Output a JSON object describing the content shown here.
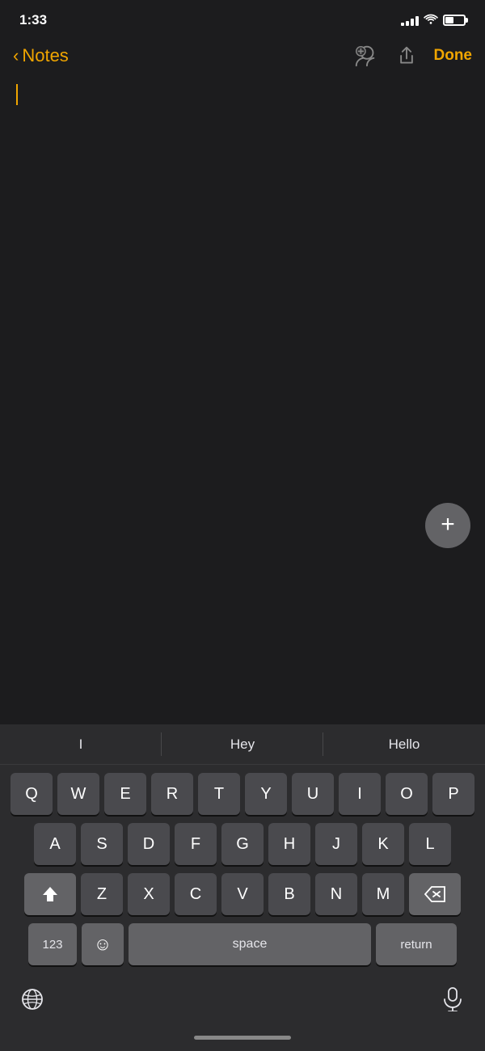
{
  "statusBar": {
    "time": "1:33"
  },
  "navBar": {
    "backLabel": "Notes",
    "doneLabel": "Done"
  },
  "predictive": {
    "items": [
      "I",
      "Hey",
      "Hello"
    ]
  },
  "keyboard": {
    "row1": [
      "Q",
      "W",
      "E",
      "R",
      "T",
      "Y",
      "U",
      "I",
      "O",
      "P"
    ],
    "row2": [
      "A",
      "S",
      "D",
      "F",
      "G",
      "H",
      "J",
      "K",
      "L"
    ],
    "row3": [
      "Z",
      "X",
      "C",
      "V",
      "B",
      "N",
      "M"
    ],
    "bottomRow": {
      "num": "123",
      "space": "space",
      "ret": "return"
    }
  },
  "addButton": {
    "label": "+"
  }
}
